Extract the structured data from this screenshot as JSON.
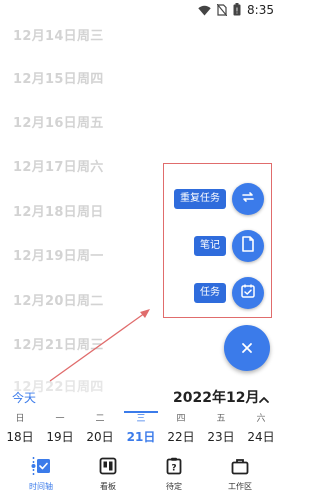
{
  "status_bar": {
    "time": "8:35",
    "icons": [
      "wifi-icon",
      "no-sim-icon",
      "battery-icon"
    ]
  },
  "timeline": {
    "dates": [
      "12月14日周三",
      "12月15日周四",
      "12月16日周五",
      "12月17日周六",
      "12月18日周日",
      "12月19日周一",
      "12月20日周二",
      "12月21日周三",
      "12月22日周四"
    ]
  },
  "fab_menu": {
    "items": [
      {
        "label": "重复任务",
        "icon": "repeat-icon"
      },
      {
        "label": "笔记",
        "icon": "note-icon"
      },
      {
        "label": "任务",
        "icon": "task-icon"
      }
    ],
    "close_icon": "close-icon",
    "accent_color": "#3b7bea",
    "highlight_color": "#e06c6c"
  },
  "week_header": {
    "today_label": "今天",
    "month_label": "2022年12月"
  },
  "week_strip": {
    "days": [
      {
        "weekday": "日",
        "date": "18日",
        "selected": false
      },
      {
        "weekday": "一",
        "date": "19日",
        "selected": false
      },
      {
        "weekday": "二",
        "date": "20日",
        "selected": false
      },
      {
        "weekday": "三",
        "date": "21日",
        "selected": true
      },
      {
        "weekday": "四",
        "date": "22日",
        "selected": false
      },
      {
        "weekday": "五",
        "date": "23日",
        "selected": false
      },
      {
        "weekday": "六",
        "date": "24日",
        "selected": false
      }
    ]
  },
  "bottom_nav": {
    "items": [
      {
        "label": "时间轴",
        "icon": "timeline-icon",
        "active": true
      },
      {
        "label": "看板",
        "icon": "kanban-icon",
        "active": false
      },
      {
        "label": "待定",
        "icon": "pending-icon",
        "active": false
      },
      {
        "label": "工作区",
        "icon": "workspace-icon",
        "active": false
      }
    ]
  }
}
